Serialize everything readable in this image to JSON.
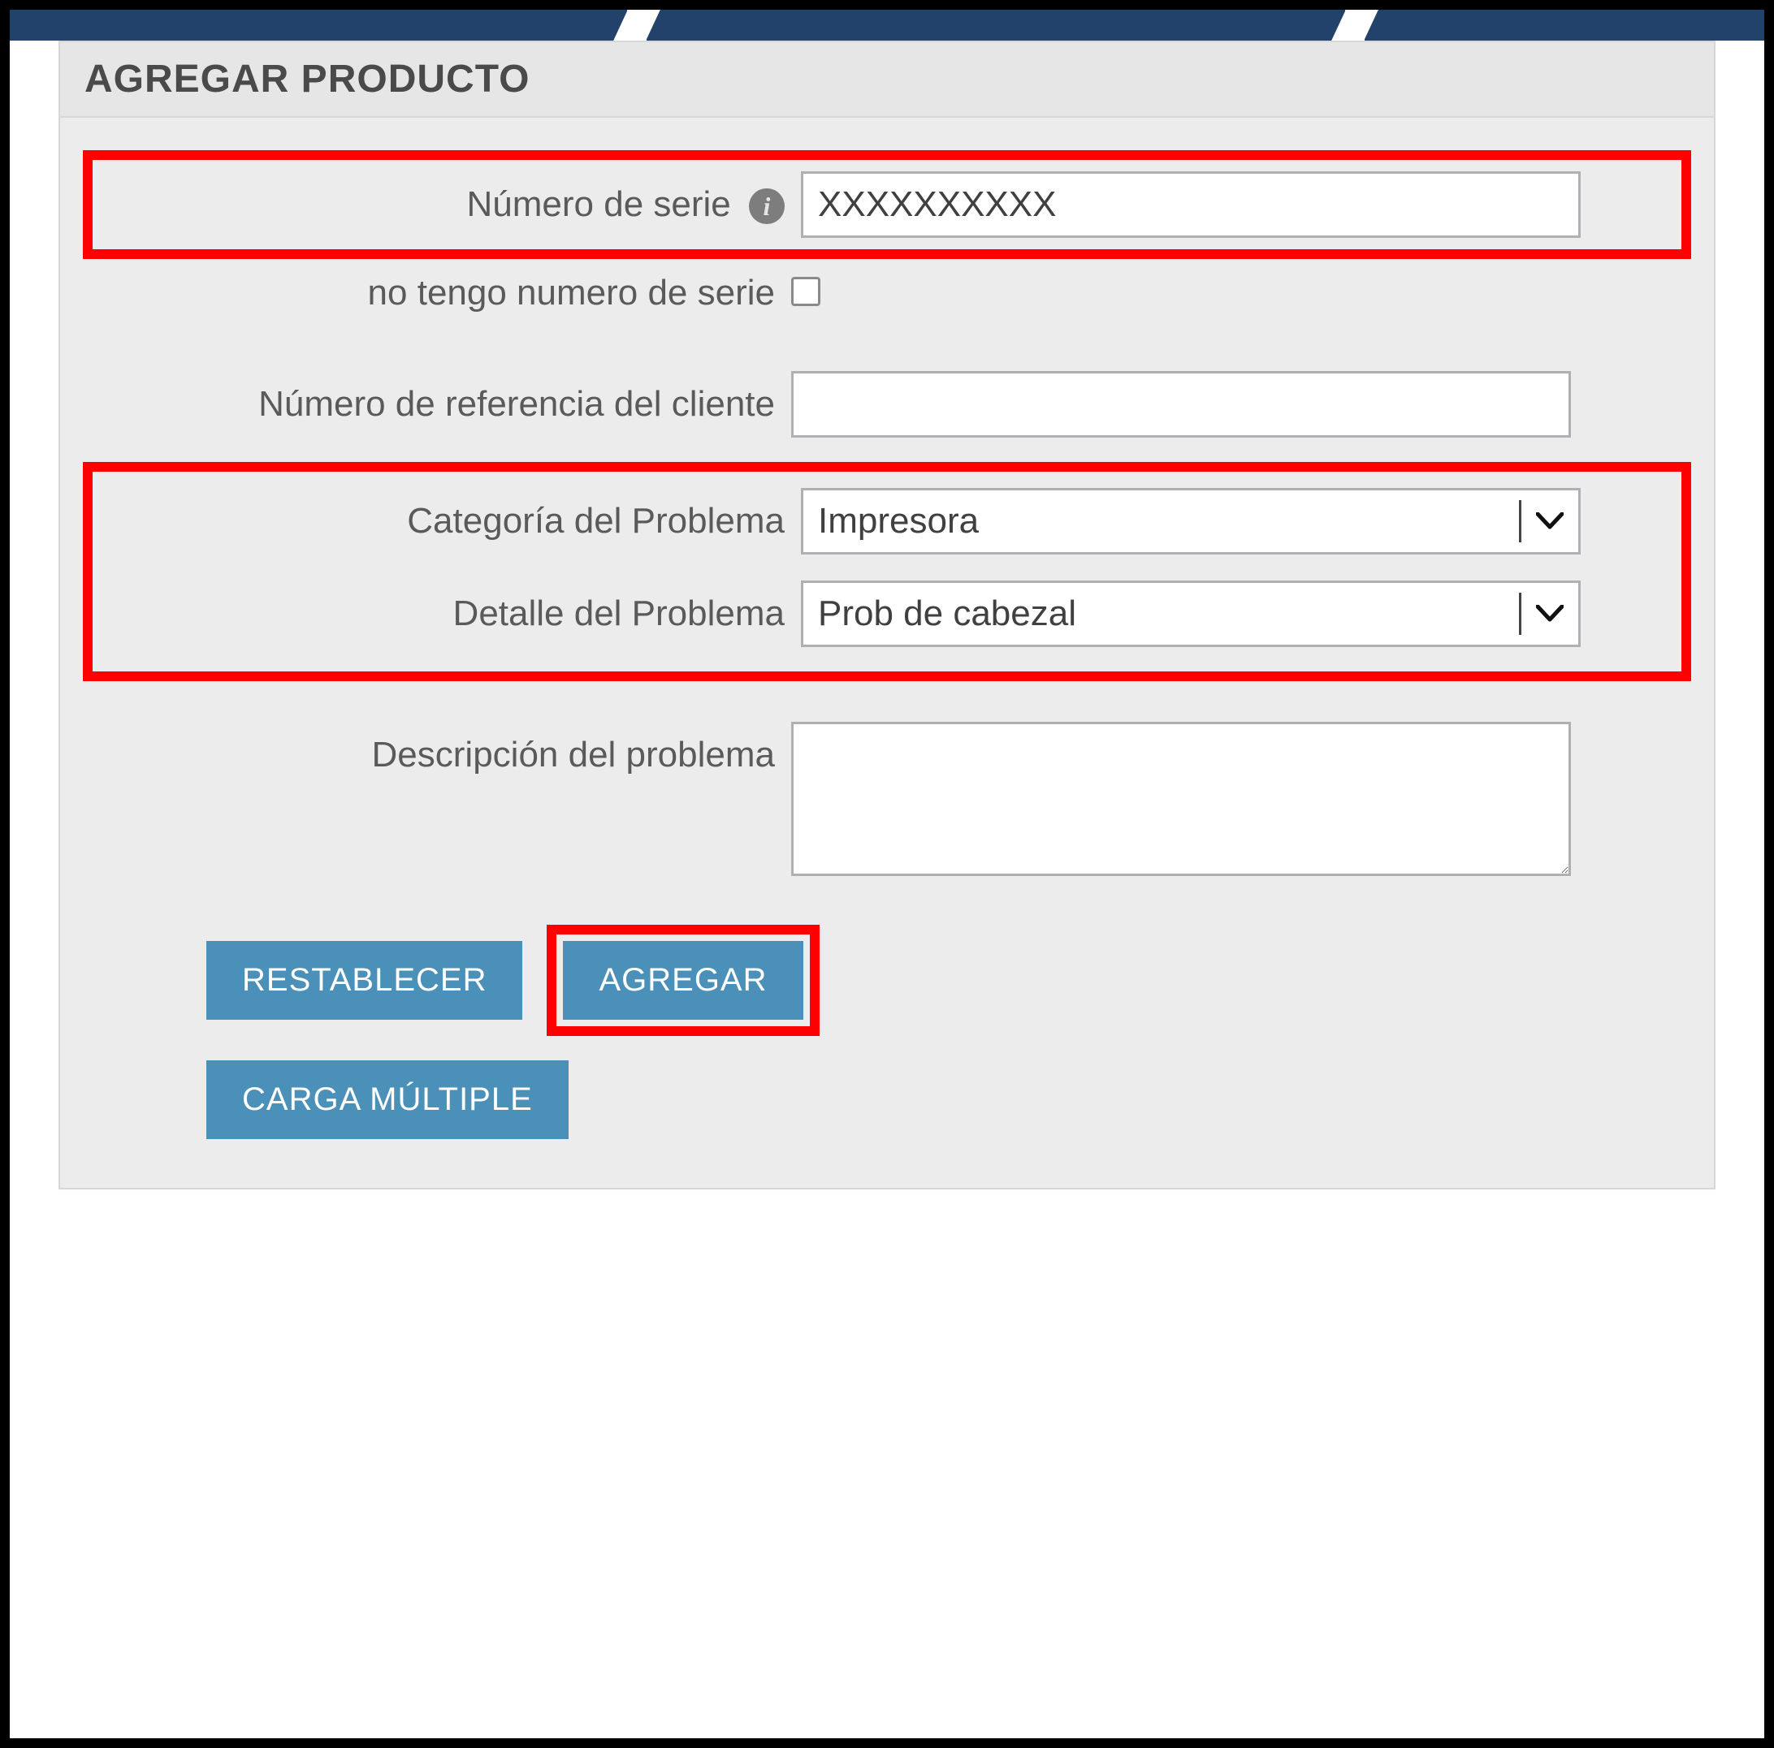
{
  "panel": {
    "title": "AGREGAR PRODUCTO"
  },
  "form": {
    "serial": {
      "label": "Número de serie",
      "value": "XXXXXXXXXX"
    },
    "no_serial": {
      "label": "no tengo numero de serie",
      "checked": false
    },
    "customer_ref": {
      "label": "Número de referencia del cliente",
      "value": ""
    },
    "problem_category": {
      "label": "Categoría del Problema",
      "value": "Impresora"
    },
    "problem_detail": {
      "label": "Detalle del Problema",
      "value": "Prob de cabezal"
    },
    "problem_description": {
      "label": "Descripción del problema",
      "value": ""
    }
  },
  "buttons": {
    "reset": "RESTABLECER",
    "add": "AGREGAR",
    "bulk": "CARGA MÚLTIPLE"
  },
  "icons": {
    "info": "i"
  }
}
